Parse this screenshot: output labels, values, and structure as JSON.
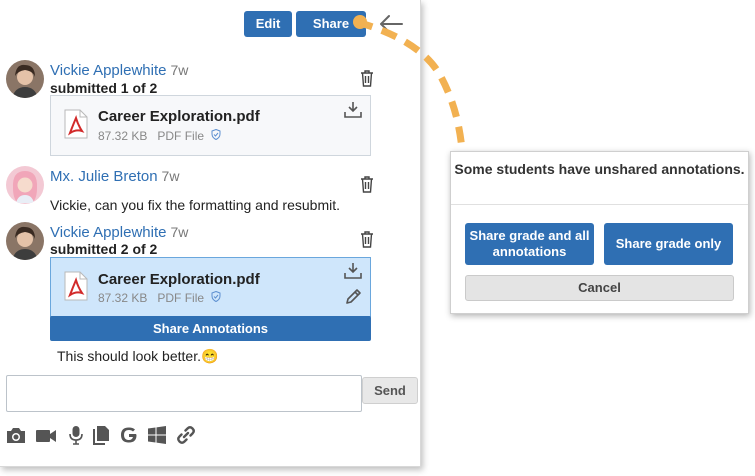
{
  "header": {
    "edit_label": "Edit",
    "share_label": "Share"
  },
  "messages": [
    {
      "author": "Vickie Applewhite",
      "ago": "7w",
      "submitted": "submitted 1 of 2",
      "file": {
        "name": "Career Exploration.pdf",
        "size": "87.32 KB",
        "type": "PDF File"
      }
    },
    {
      "author": "Mx. Julie Breton",
      "ago": "7w",
      "text": "Vickie, can you fix the formatting and resubmit."
    },
    {
      "author": "Vickie Applewhite",
      "ago": "7w",
      "submitted": "submitted 2 of 2",
      "file": {
        "name": "Career Exploration.pdf",
        "size": "87.32 KB",
        "type": "PDF File"
      },
      "share_annotations_label": "Share Annotations",
      "comment": "This should look better.😁"
    }
  ],
  "compose": {
    "placeholder": "",
    "send_label": "Send"
  },
  "toolbar_icons": [
    "camera-icon",
    "video-icon",
    "microphone-icon",
    "documents-icon",
    "google-icon",
    "windows-icon",
    "link-icon"
  ],
  "dialog": {
    "title": "Some students have unshared annotations.",
    "share_all_label": "Share grade and all annotations",
    "share_grade_label": "Share grade only",
    "cancel_label": "Cancel"
  },
  "colors": {
    "primary": "#2f6fb3",
    "selected_file_bg": "#cfe6fb",
    "connector": "#f2b151"
  }
}
